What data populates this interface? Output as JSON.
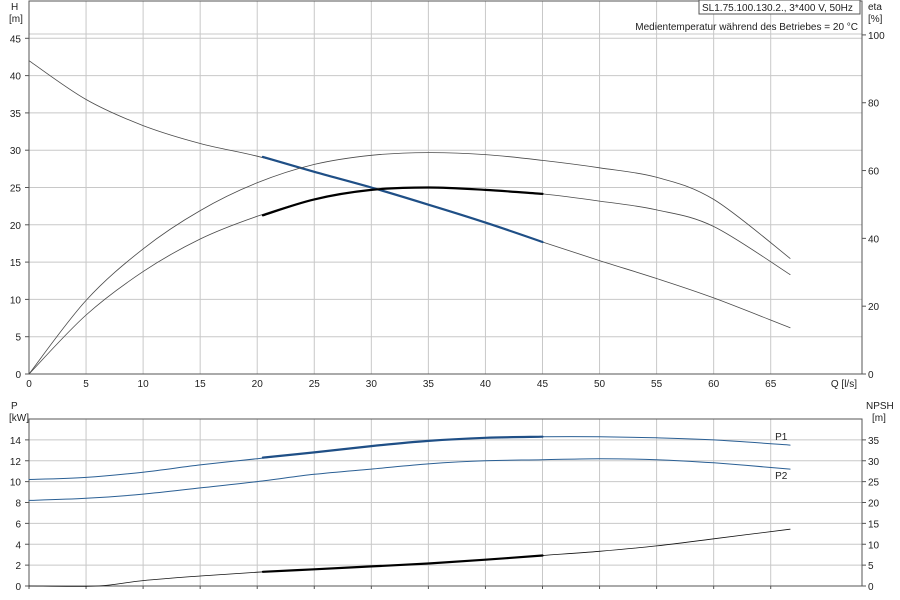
{
  "header": {
    "model": "SL1.75.100.130.2., 3*400 V, 50Hz",
    "note": "Medientemperatur während des Betriebes = 20 °C"
  },
  "chart_data": [
    {
      "type": "line",
      "left_axis": {
        "label": "H",
        "unit": "[m]",
        "ylim": [
          0,
          50
        ],
        "ticks": [
          0,
          5,
          10,
          15,
          20,
          25,
          30,
          35,
          40,
          45
        ]
      },
      "right_axis": {
        "label": "eta",
        "unit": "[%]",
        "ylim": [
          0,
          110
        ],
        "ticks": [
          0,
          20,
          40,
          60,
          80,
          100
        ]
      },
      "x_axis": {
        "label": "Q [l/s]",
        "xlim": [
          0,
          73
        ],
        "ticks": [
          0,
          5,
          10,
          15,
          20,
          25,
          30,
          35,
          40,
          45,
          50,
          55,
          60,
          65
        ]
      },
      "grid": true,
      "series": [
        {
          "id": "h",
          "axis": "left",
          "color": "#4a4a4a",
          "width": 0.8,
          "x": [
            0,
            5,
            10,
            15,
            20,
            25,
            30,
            35,
            40,
            45,
            50,
            55,
            60,
            66.7
          ],
          "y": [
            42,
            36.8,
            33.3,
            30.9,
            29.2,
            27.1,
            25,
            22.7,
            20.3,
            17.7,
            15.2,
            12.8,
            10.2,
            6.2
          ]
        },
        {
          "id": "h-op",
          "axis": "left",
          "color": "#1f4f86",
          "width": 2.2,
          "x": [
            20.5,
            25,
            30,
            35,
            40,
            45
          ],
          "y": [
            29.1,
            27.1,
            25,
            22.7,
            20.3,
            17.7
          ]
        },
        {
          "id": "eta1",
          "axis": "right",
          "color": "#4a4a4a",
          "width": 0.8,
          "x": [
            0,
            5,
            10,
            15,
            20,
            25,
            30,
            35,
            40,
            45,
            50,
            55,
            60,
            66.7
          ],
          "y": [
            0,
            21.7,
            36.9,
            48.2,
            56.4,
            61.8,
            64.5,
            65.3,
            64.7,
            63.0,
            60.8,
            58.0,
            51.5,
            34.1
          ]
        },
        {
          "id": "eta2",
          "axis": "right",
          "color": "#4a4a4a",
          "width": 0.8,
          "x": [
            0,
            5,
            10,
            15,
            20,
            25,
            30,
            35,
            40,
            45,
            50,
            55,
            60,
            66.7
          ],
          "y": [
            0,
            17.4,
            30.2,
            39.8,
            46.5,
            51.5,
            54.3,
            55.0,
            54.3,
            53.1,
            51.0,
            48.4,
            43.5,
            29.3
          ]
        },
        {
          "id": "eta2-op",
          "axis": "right",
          "color": "#000000",
          "width": 2.2,
          "x": [
            20.5,
            25,
            30,
            35,
            40,
            45
          ],
          "y": [
            46.8,
            51.5,
            54.3,
            55.0,
            54.3,
            53.1
          ]
        }
      ]
    },
    {
      "type": "line",
      "left_axis": {
        "label": "P",
        "unit": "[kW]",
        "ylim": [
          0,
          16
        ],
        "ticks": [
          0,
          2,
          4,
          6,
          8,
          10,
          12,
          14
        ]
      },
      "right_axis": {
        "label": "NPSH",
        "unit": "[m]",
        "ylim": [
          0,
          40
        ],
        "ticks": [
          0,
          5,
          10,
          15,
          20,
          25,
          30,
          35
        ]
      },
      "x_axis": {
        "xlim": [
          0,
          73
        ],
        "ticks": [
          0,
          5,
          10,
          15,
          20,
          25,
          30,
          35,
          40,
          45,
          50,
          55,
          60,
          65
        ]
      },
      "grid": true,
      "series": [
        {
          "id": "p1",
          "name": "P1",
          "axis": "left",
          "color": "#2a5f94",
          "width": 1,
          "x": [
            0,
            5,
            10,
            15,
            20,
            25,
            30,
            35,
            40,
            45,
            50,
            55,
            60,
            66.7
          ],
          "y": [
            10.2,
            10.4,
            10.9,
            11.6,
            12.2,
            12.8,
            13.4,
            13.9,
            14.2,
            14.3,
            14.3,
            14.2,
            14.0,
            13.5
          ]
        },
        {
          "id": "p1-op",
          "axis": "left",
          "color": "#1f4f86",
          "width": 2.2,
          "x": [
            20.5,
            25,
            30,
            35,
            40,
            45
          ],
          "y": [
            12.3,
            12.8,
            13.4,
            13.9,
            14.2,
            14.3
          ]
        },
        {
          "id": "p2",
          "name": "P2",
          "axis": "left",
          "color": "#2a5f94",
          "width": 1,
          "x": [
            0,
            5,
            10,
            15,
            20,
            25,
            30,
            35,
            40,
            45,
            50,
            55,
            60,
            66.7
          ],
          "y": [
            8.2,
            8.4,
            8.8,
            9.4,
            10.0,
            10.7,
            11.2,
            11.7,
            12.0,
            12.1,
            12.2,
            12.1,
            11.8,
            11.2
          ]
        },
        {
          "id": "npsh",
          "axis": "right",
          "color": "#111111",
          "width": 0.8,
          "x": [
            0,
            6,
            10,
            15,
            20,
            25,
            30,
            35,
            40,
            45,
            50,
            55,
            60,
            66.7
          ],
          "y": [
            0,
            0,
            1.3,
            2.4,
            3.3,
            4.0,
            4.7,
            5.4,
            6.3,
            7.3,
            8.3,
            9.6,
            11.3,
            13.6
          ]
        },
        {
          "id": "npsh-op",
          "axis": "right",
          "color": "#000000",
          "width": 2.2,
          "x": [
            20.5,
            25,
            30,
            35,
            40,
            45
          ],
          "y": [
            3.4,
            4.0,
            4.7,
            5.4,
            6.3,
            7.3
          ]
        }
      ]
    }
  ]
}
